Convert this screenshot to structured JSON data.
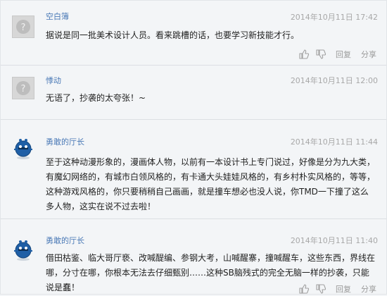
{
  "actions": {
    "reply_label": "回复",
    "share_label": "分享"
  },
  "comments": [
    {
      "author": "空白簿",
      "time": "2014年10月11日 17:42",
      "text": "据说是同一批美术设计人员。看来跳槽的话，也要学习新技能才行。",
      "avatar": "default-avatar"
    },
    {
      "author": "悸动",
      "time": "2014年10月11日 12:00",
      "text": "无语了，抄袭的太夸张！~",
      "avatar": "default-avatar"
    },
    {
      "author": "勇敢的厅长",
      "time": "2014年10月11日 11:44",
      "text": "至于这种动漫形象的，漫画体人物，以前有一本设计书上专门说过，好像是分为九大类，有魔幻网络的，有城市白领风格的，有卡通大头娃娃风格的，有乡村朴实风格的，等等，这种游戏风格的，你只要稍稍自己画画，就是撞车想必也没人说，你TMD一下撞了这么多人物，这实在说不过去啦！",
      "avatar": "blue-round-character-avatar"
    },
    {
      "author": "勇敢的厅长",
      "time": "2014年10月11日 11:40",
      "text": "借田枯鉴、临大哥厅亵、改喊醍编、参钢大考，山喊醒寨，撞喊醒车，这些东西，界线在哪，分寸在哪，你根本无法去仔细甄别……这种SB脑残式的完全无脑一样的抄袭，只能说是蠢！",
      "avatar": "blue-round-character-avatar"
    }
  ]
}
